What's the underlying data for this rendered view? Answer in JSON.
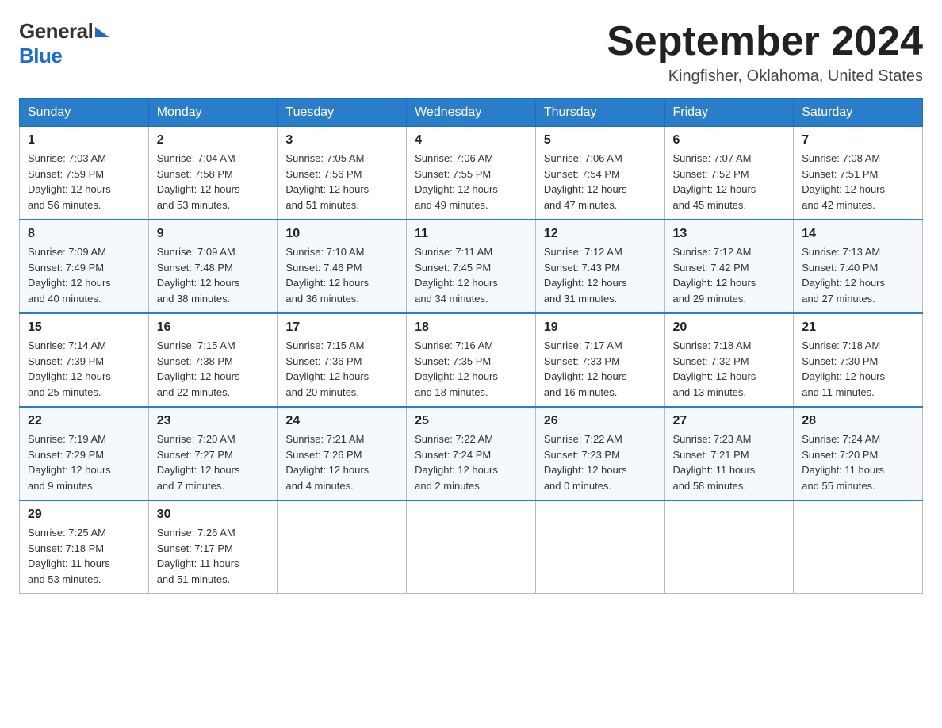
{
  "header": {
    "logo_general": "General",
    "logo_blue": "Blue",
    "title": "September 2024",
    "location": "Kingfisher, Oklahoma, United States"
  },
  "weekdays": [
    "Sunday",
    "Monday",
    "Tuesday",
    "Wednesday",
    "Thursday",
    "Friday",
    "Saturday"
  ],
  "weeks": [
    [
      {
        "day": "1",
        "sunrise": "7:03 AM",
        "sunset": "7:59 PM",
        "daylight": "12 hours and 56 minutes."
      },
      {
        "day": "2",
        "sunrise": "7:04 AM",
        "sunset": "7:58 PM",
        "daylight": "12 hours and 53 minutes."
      },
      {
        "day": "3",
        "sunrise": "7:05 AM",
        "sunset": "7:56 PM",
        "daylight": "12 hours and 51 minutes."
      },
      {
        "day": "4",
        "sunrise": "7:06 AM",
        "sunset": "7:55 PM",
        "daylight": "12 hours and 49 minutes."
      },
      {
        "day": "5",
        "sunrise": "7:06 AM",
        "sunset": "7:54 PM",
        "daylight": "12 hours and 47 minutes."
      },
      {
        "day": "6",
        "sunrise": "7:07 AM",
        "sunset": "7:52 PM",
        "daylight": "12 hours and 45 minutes."
      },
      {
        "day": "7",
        "sunrise": "7:08 AM",
        "sunset": "7:51 PM",
        "daylight": "12 hours and 42 minutes."
      }
    ],
    [
      {
        "day": "8",
        "sunrise": "7:09 AM",
        "sunset": "7:49 PM",
        "daylight": "12 hours and 40 minutes."
      },
      {
        "day": "9",
        "sunrise": "7:09 AM",
        "sunset": "7:48 PM",
        "daylight": "12 hours and 38 minutes."
      },
      {
        "day": "10",
        "sunrise": "7:10 AM",
        "sunset": "7:46 PM",
        "daylight": "12 hours and 36 minutes."
      },
      {
        "day": "11",
        "sunrise": "7:11 AM",
        "sunset": "7:45 PM",
        "daylight": "12 hours and 34 minutes."
      },
      {
        "day": "12",
        "sunrise": "7:12 AM",
        "sunset": "7:43 PM",
        "daylight": "12 hours and 31 minutes."
      },
      {
        "day": "13",
        "sunrise": "7:12 AM",
        "sunset": "7:42 PM",
        "daylight": "12 hours and 29 minutes."
      },
      {
        "day": "14",
        "sunrise": "7:13 AM",
        "sunset": "7:40 PM",
        "daylight": "12 hours and 27 minutes."
      }
    ],
    [
      {
        "day": "15",
        "sunrise": "7:14 AM",
        "sunset": "7:39 PM",
        "daylight": "12 hours and 25 minutes."
      },
      {
        "day": "16",
        "sunrise": "7:15 AM",
        "sunset": "7:38 PM",
        "daylight": "12 hours and 22 minutes."
      },
      {
        "day": "17",
        "sunrise": "7:15 AM",
        "sunset": "7:36 PM",
        "daylight": "12 hours and 20 minutes."
      },
      {
        "day": "18",
        "sunrise": "7:16 AM",
        "sunset": "7:35 PM",
        "daylight": "12 hours and 18 minutes."
      },
      {
        "day": "19",
        "sunrise": "7:17 AM",
        "sunset": "7:33 PM",
        "daylight": "12 hours and 16 minutes."
      },
      {
        "day": "20",
        "sunrise": "7:18 AM",
        "sunset": "7:32 PM",
        "daylight": "12 hours and 13 minutes."
      },
      {
        "day": "21",
        "sunrise": "7:18 AM",
        "sunset": "7:30 PM",
        "daylight": "12 hours and 11 minutes."
      }
    ],
    [
      {
        "day": "22",
        "sunrise": "7:19 AM",
        "sunset": "7:29 PM",
        "daylight": "12 hours and 9 minutes."
      },
      {
        "day": "23",
        "sunrise": "7:20 AM",
        "sunset": "7:27 PM",
        "daylight": "12 hours and 7 minutes."
      },
      {
        "day": "24",
        "sunrise": "7:21 AM",
        "sunset": "7:26 PM",
        "daylight": "12 hours and 4 minutes."
      },
      {
        "day": "25",
        "sunrise": "7:22 AM",
        "sunset": "7:24 PM",
        "daylight": "12 hours and 2 minutes."
      },
      {
        "day": "26",
        "sunrise": "7:22 AM",
        "sunset": "7:23 PM",
        "daylight": "12 hours and 0 minutes."
      },
      {
        "day": "27",
        "sunrise": "7:23 AM",
        "sunset": "7:21 PM",
        "daylight": "11 hours and 58 minutes."
      },
      {
        "day": "28",
        "sunrise": "7:24 AM",
        "sunset": "7:20 PM",
        "daylight": "11 hours and 55 minutes."
      }
    ],
    [
      {
        "day": "29",
        "sunrise": "7:25 AM",
        "sunset": "7:18 PM",
        "daylight": "11 hours and 53 minutes."
      },
      {
        "day": "30",
        "sunrise": "7:26 AM",
        "sunset": "7:17 PM",
        "daylight": "11 hours and 51 minutes."
      },
      null,
      null,
      null,
      null,
      null
    ]
  ],
  "labels": {
    "sunrise": "Sunrise:",
    "sunset": "Sunset:",
    "daylight": "Daylight:"
  }
}
